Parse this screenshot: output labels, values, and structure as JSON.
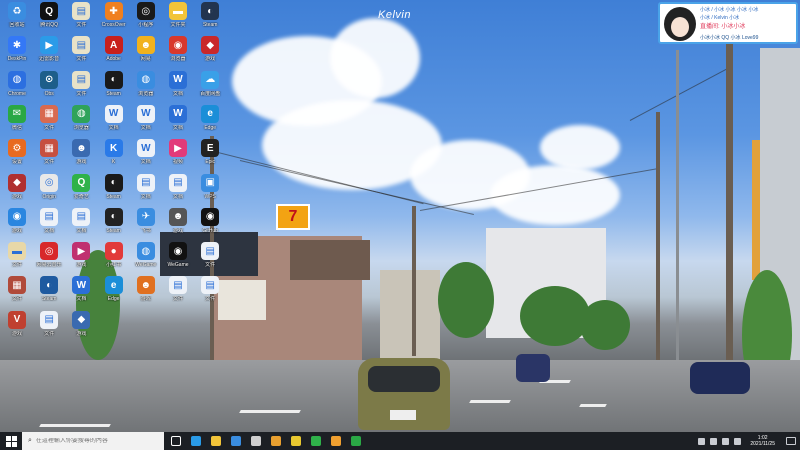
{
  "watermark": "Kelvin",
  "banner": {
    "line1": "小冰 / 小冰 小冰 小冰 小冰",
    "line2": "小冰 / Kelvin 小冰",
    "line3": "直播间: 小冰小冰",
    "line4": "小冰小冰 QQ 小冰 Love99"
  },
  "storefront_sign": "7",
  "desktop_icons": [
    {
      "label": "回收站",
      "icon": "recycle-bin-icon",
      "color": "#3a8de0",
      "glyph": "♻"
    },
    {
      "label": "腾讯QQ",
      "icon": "qq-icon",
      "color": "#111111",
      "glyph": "Q"
    },
    {
      "label": "文件",
      "icon": "file-icon",
      "color": "#e8e2c8",
      "glyph": "▤"
    },
    {
      "label": "CrossOver",
      "icon": "crossover-icon",
      "color": "#f08020",
      "glyph": "✚"
    },
    {
      "label": "小程序",
      "icon": "app-icon",
      "color": "#1a1a1a",
      "glyph": "◎"
    },
    {
      "label": "文件夹",
      "icon": "folder-icon",
      "color": "#f2c43a",
      "glyph": "▬"
    },
    {
      "label": "Steam",
      "icon": "steam-icon",
      "color": "#22344f",
      "glyph": "◐"
    },
    {
      "label": "DeskPin",
      "icon": "pin-icon",
      "color": "#3478f6",
      "glyph": "✱"
    },
    {
      "label": "迅雷影音",
      "icon": "player-icon",
      "color": "#2b9be8",
      "glyph": "▶"
    },
    {
      "label": "文件",
      "icon": "file-icon",
      "color": "#e8e2c8",
      "glyph": "▤"
    },
    {
      "label": "Adobe",
      "icon": "adobe-icon",
      "color": "#c8201c",
      "glyph": "A"
    },
    {
      "label": "网易",
      "icon": "game-icon",
      "color": "#f1b21e",
      "glyph": "☻"
    },
    {
      "label": "浏览器",
      "icon": "browser-icon",
      "color": "#d8382c",
      "glyph": "◉"
    },
    {
      "label": "游戏",
      "icon": "game-icon",
      "color": "#c9282a",
      "glyph": "◆"
    },
    {
      "label": "Chrome",
      "icon": "chrome-icon",
      "color": "#2c6fe0",
      "glyph": "◍"
    },
    {
      "label": "Obs",
      "icon": "obs-icon",
      "color": "#1d5e8a",
      "glyph": "⊙"
    },
    {
      "label": "文件",
      "icon": "file-icon",
      "color": "#e8e2c8",
      "glyph": "▤"
    },
    {
      "label": "Steam",
      "icon": "steam-icon",
      "color": "#1a1a1a",
      "glyph": "◐"
    },
    {
      "label": "浏览器",
      "icon": "browser-icon",
      "color": "#3a8de0",
      "glyph": "◍"
    },
    {
      "label": "文档",
      "icon": "doc-icon",
      "color": "#2b6fd6",
      "glyph": "W"
    },
    {
      "label": "百度网盘",
      "icon": "cloud-icon",
      "color": "#3aa0e8",
      "glyph": "☁"
    },
    {
      "label": "微信",
      "icon": "wechat-icon",
      "color": "#2aa845",
      "glyph": "✉"
    },
    {
      "label": "文件",
      "icon": "photo-icon",
      "color": "#d86a50",
      "glyph": "▦"
    },
    {
      "label": "浏览器",
      "icon": "browser-icon",
      "color": "#2fa35a",
      "glyph": "◍"
    },
    {
      "label": "文档",
      "icon": "doc-icon",
      "color": "#eef2f8",
      "glyph": "W"
    },
    {
      "label": "文档",
      "icon": "doc-icon",
      "color": "#eef2f8",
      "glyph": "W"
    },
    {
      "label": "文档",
      "icon": "doc-icon",
      "color": "#2b6fd6",
      "glyph": "W"
    },
    {
      "label": "Edge",
      "icon": "edge-icon",
      "color": "#1b8ed8",
      "glyph": "e"
    },
    {
      "label": "设置",
      "icon": "gear-icon",
      "color": "#e86a20",
      "glyph": "⚙"
    },
    {
      "label": "文件",
      "icon": "photo-icon",
      "color": "#c65040",
      "glyph": "▦"
    },
    {
      "label": "游戏",
      "icon": "game-icon",
      "color": "#3a6ab0",
      "glyph": "☻"
    },
    {
      "label": "K",
      "icon": "k-icon",
      "color": "#2a7ae8",
      "glyph": "K"
    },
    {
      "label": "文档",
      "icon": "doc-icon",
      "color": "#eef2f8",
      "glyph": "W"
    },
    {
      "label": "视频",
      "icon": "video-icon",
      "color": "#e23a7a",
      "glyph": "▶"
    },
    {
      "label": "Epic",
      "icon": "epic-icon",
      "color": "#222222",
      "glyph": "E"
    },
    {
      "label": "游戏",
      "icon": "game-icon",
      "color": "#b03030",
      "glyph": "◆"
    },
    {
      "label": "Origin",
      "icon": "origin-icon",
      "color": "#e8e8e8",
      "glyph": "◎"
    },
    {
      "label": "爱奇艺",
      "icon": "iqiyi-icon",
      "color": "#2fb24a",
      "glyph": "Q"
    },
    {
      "label": "Steam",
      "icon": "steam-icon",
      "color": "#1a1a1a",
      "glyph": "◐"
    },
    {
      "label": "文档",
      "icon": "doc-icon",
      "color": "#eef2f8",
      "glyph": "▤"
    },
    {
      "label": "文档",
      "icon": "doc-icon",
      "color": "#eef2f8",
      "glyph": "▤"
    },
    {
      "label": "WPS",
      "icon": "wps-icon",
      "color": "#3a8de0",
      "glyph": "▣"
    },
    {
      "label": "游戏",
      "icon": "game-icon",
      "color": "#2a86e0",
      "glyph": "◉"
    },
    {
      "label": "文档",
      "icon": "doc-icon",
      "color": "#eef2f8",
      "glyph": "▤"
    },
    {
      "label": "文档",
      "icon": "doc-icon",
      "color": "#eef2f8",
      "glyph": "▤"
    },
    {
      "label": "Steam",
      "icon": "steam-icon",
      "color": "#222222",
      "glyph": "◐"
    },
    {
      "label": "飞书",
      "icon": "feishu-icon",
      "color": "#3a8de0",
      "glyph": "✈"
    },
    {
      "label": "游戏",
      "icon": "game-icon",
      "color": "#555555",
      "glyph": "☻"
    },
    {
      "label": "GitHub",
      "icon": "github-icon",
      "color": "#111111",
      "glyph": "◉"
    },
    {
      "label": "文件",
      "icon": "folder-icon",
      "color": "#e8d8a8",
      "glyph": "▬"
    },
    {
      "label": "网易云音乐",
      "icon": "music-icon",
      "color": "#d8282a",
      "glyph": "◎"
    },
    {
      "label": "游戏",
      "icon": "game-icon",
      "color": "#c03070",
      "glyph": "▶"
    },
    {
      "label": "小红书",
      "icon": "app-icon",
      "color": "#e23a3a",
      "glyph": "●"
    },
    {
      "label": "WeGame",
      "icon": "wegame-icon",
      "color": "#3a8de0",
      "glyph": "◍"
    },
    {
      "label": "WeGame",
      "icon": "wegame-icon",
      "color": "#111111",
      "glyph": "◉"
    },
    {
      "label": "文件",
      "icon": "doc-icon",
      "color": "#eef2f8",
      "glyph": "▤"
    },
    {
      "label": "文件",
      "icon": "photo-icon",
      "color": "#b04a3a",
      "glyph": "▦"
    },
    {
      "label": "Steam",
      "icon": "steam-icon",
      "color": "#1e5aa0",
      "glyph": "◐"
    },
    {
      "label": "文档",
      "icon": "doc-icon",
      "color": "#2b6fd6",
      "glyph": "W"
    },
    {
      "label": "Edge",
      "icon": "edge-icon",
      "color": "#1b8ed8",
      "glyph": "e"
    },
    {
      "label": "游戏",
      "icon": "game-icon",
      "color": "#e07020",
      "glyph": "☻"
    },
    {
      "label": "文件",
      "icon": "doc-icon",
      "color": "#eef2f8",
      "glyph": "▤"
    },
    {
      "label": "文件",
      "icon": "doc-icon",
      "color": "#eef2f8",
      "glyph": "▤"
    },
    {
      "label": "游戏",
      "icon": "game-icon",
      "color": "#c04030",
      "glyph": "V"
    },
    {
      "label": "文件",
      "icon": "doc-icon",
      "color": "#eef2f8",
      "glyph": "▤"
    },
    {
      "label": "游戏",
      "icon": "game-icon",
      "color": "#3a6ab0",
      "glyph": "◆"
    }
  ],
  "taskbar": {
    "search_placeholder": "在這裡輸入你要搜尋的內容",
    "apps": [
      {
        "name": "task-view-icon",
        "color": "#ffffff"
      },
      {
        "name": "edge-icon",
        "color": "#2a9be8"
      },
      {
        "name": "file-explorer-icon",
        "color": "#f2c43a"
      },
      {
        "name": "store-icon",
        "color": "#3a8de0"
      },
      {
        "name": "obs-icon",
        "color": "#cfcfcf"
      },
      {
        "name": "folder-icon",
        "color": "#e8a030"
      },
      {
        "name": "chrome-icon",
        "color": "#e8c830"
      },
      {
        "name": "app-icon",
        "color": "#2fb24a"
      },
      {
        "name": "app-icon-2",
        "color": "#f0a030"
      },
      {
        "name": "wechat-icon",
        "color": "#2aa845"
      }
    ],
    "time": "1:02",
    "date": "2021/11/25"
  }
}
